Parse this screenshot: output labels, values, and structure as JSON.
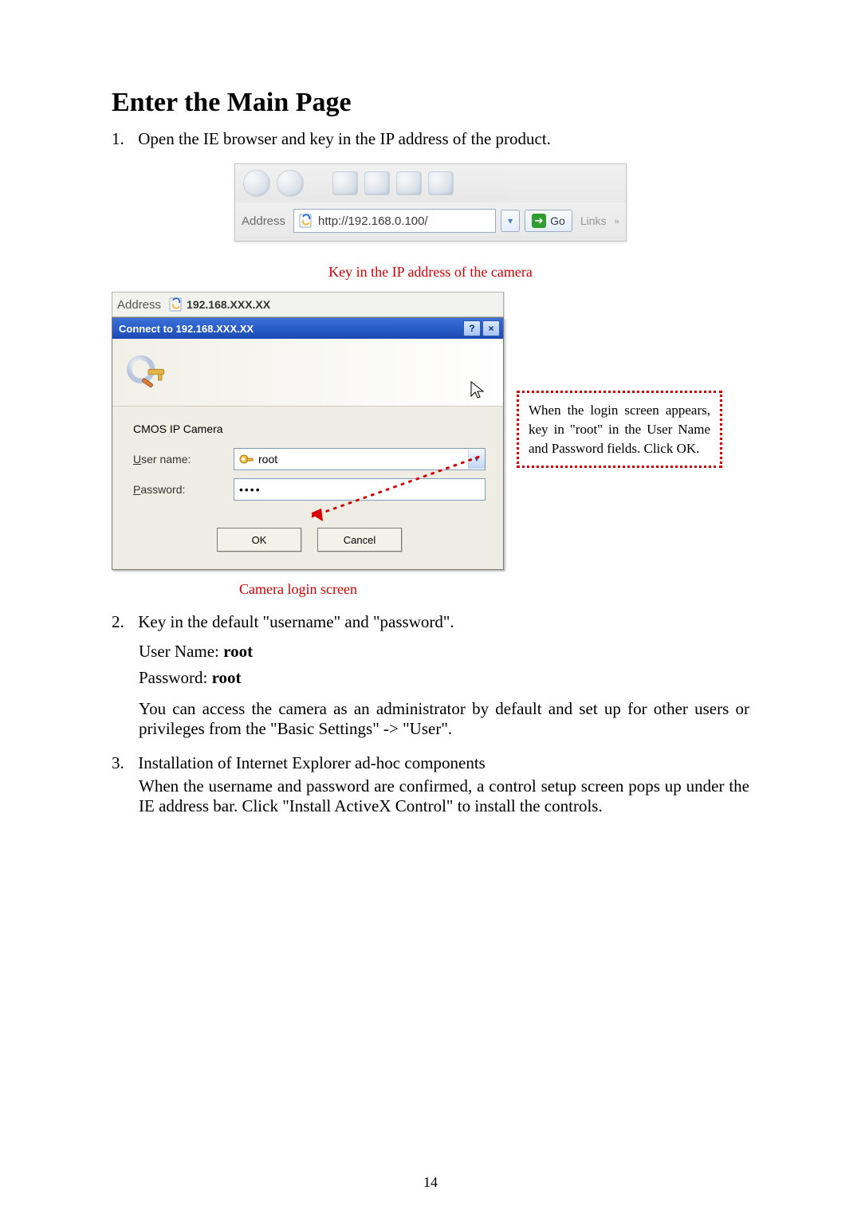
{
  "heading": "Enter the Main Page",
  "step1_num": "1.",
  "step1_text": "Open the IE browser and key in the IP address of the product.",
  "toolbar": {
    "address_label": "Address",
    "url1": "http://192.168.0.100/",
    "go_label": "Go",
    "links_label": "Links"
  },
  "caption1": "Key in the IP address of the camera",
  "addr_strip_text": "192.168.XXX.XX",
  "dialog": {
    "title": "Connect to 192.168.XXX.XX",
    "device": "CMOS IP Camera",
    "user_label_pre": "U",
    "user_label_rest": "ser name:",
    "user_value": "root",
    "pass_label_pre": "P",
    "pass_label_rest": "assword:",
    "pass_value": "••••",
    "ok": "OK",
    "cancel": "Cancel",
    "help_char": "?",
    "close_char": "×"
  },
  "callout_text": "When the login screen appears, key in \"root\" in the User Name and Password fields. Click OK.",
  "caption2": "Camera login screen",
  "step2_num": "2.",
  "step2_text": "Key in the default \"username\" and \"password\".",
  "creds": {
    "un_label": "User Name: ",
    "un_value": "root",
    "pw_label": "Password: ",
    "pw_value": "root"
  },
  "step2_body": "You can access the camera as an administrator by default and set up for other users or privileges from the \"Basic Settings\" -> \"User\".",
  "step3_num": "3.",
  "step3_line1": "Installation of Internet Explorer ad-hoc components",
  "step3_body": "When the username and password are confirmed, a control setup screen pops up under the IE address bar. Click \"Install ActiveX Control\" to install the controls.",
  "page_number": "14"
}
